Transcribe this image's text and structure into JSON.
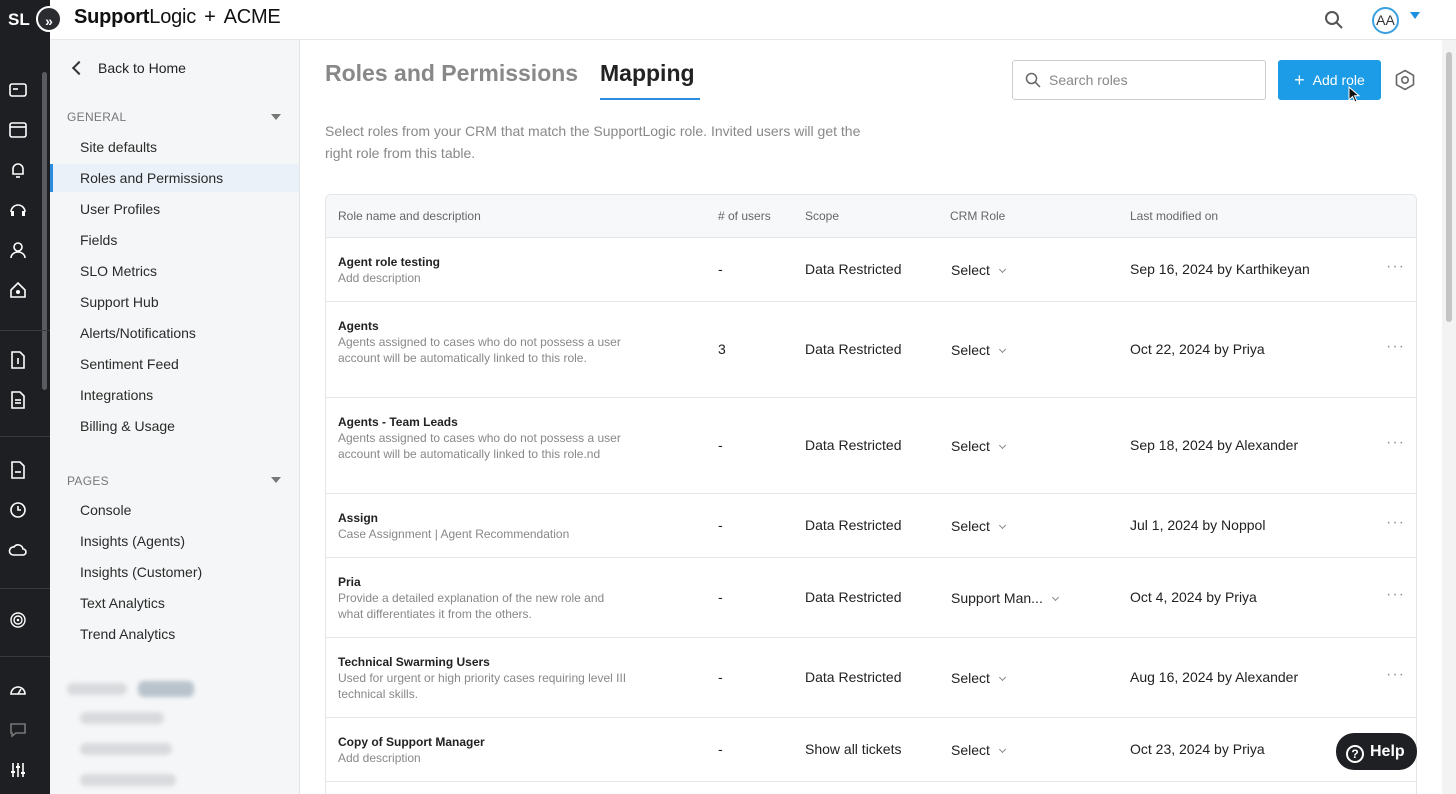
{
  "topbar": {
    "badge": "SL",
    "expand": "»",
    "brand_bold": "Support",
    "brand_rest": "Logic",
    "plus": "+",
    "org": "ACME",
    "avatar": "AA"
  },
  "sidebar": {
    "back": "Back to Home",
    "general_title": "GENERAL",
    "general_items": [
      "Site defaults",
      "Roles and Permissions",
      "User Profiles",
      "Fields",
      "SLO Metrics",
      "Support Hub",
      "Alerts/Notifications",
      "Sentiment Feed",
      "Integrations",
      "Billing & Usage"
    ],
    "pages_title": "PAGES",
    "pages_items": [
      "Console",
      "Insights (Agents)",
      "Insights (Customer)",
      "Text Analytics",
      "Trend Analytics"
    ],
    "active": "Roles and Permissions"
  },
  "main": {
    "tab_roles": "Roles and Permissions",
    "tab_mapping": "Mapping",
    "search_placeholder": "Search roles",
    "add_label": "Add role",
    "description": "Select roles from your CRM that match the SupportLogic role. Invited users will get the right role from this table."
  },
  "table": {
    "headers": [
      "Role name and description",
      "# of users",
      "Scope",
      "CRM Role",
      "Last modified on"
    ],
    "rows": [
      {
        "name": "Agent role testing",
        "desc": "Add description",
        "users": "-",
        "scope": "Data Restricted",
        "crm": "Select",
        "modified": "Sep 16, 2024 by Karthikeyan"
      },
      {
        "name": "Agents",
        "desc": "Agents assigned to cases who do not possess a user account will be automatically linked to this role.",
        "users": "3",
        "scope": "Data Restricted",
        "crm": "Select",
        "modified": "Oct 22, 2024 by Priya"
      },
      {
        "name": "Agents - Team Leads",
        "desc": "Agents assigned to cases who do not possess a user account will be automatically linked to this role.nd",
        "users": "-",
        "scope": "Data Restricted",
        "crm": "Select",
        "modified": "Sep 18, 2024 by Alexander"
      },
      {
        "name": "Assign",
        "desc": "Case Assignment | Agent Recommendation",
        "users": "-",
        "scope": "Data Restricted",
        "crm": "Select",
        "modified": "Jul 1, 2024 by Noppol"
      },
      {
        "name": "Pria",
        "desc": "Provide a detailed explanation of the new role and what differentiates it from the others.",
        "users": "-",
        "scope": "Data Restricted",
        "crm": "Support Man...",
        "modified": "Oct 4, 2024 by Priya"
      },
      {
        "name": "Technical Swarming Users",
        "desc": "Used for urgent or high priority cases requiring level III technical skills.",
        "users": "-",
        "scope": "Data Restricted",
        "crm": "Select",
        "modified": "Aug 16, 2024 by Alexander"
      },
      {
        "name": "Copy of Support Manager",
        "desc": "Add description",
        "users": "-",
        "scope": "Show all tickets",
        "crm": "Select",
        "modified": "Oct 23, 2024 by Priya"
      }
    ],
    "more": "···"
  },
  "help": {
    "label": "Help",
    "q": "?"
  },
  "colors": {
    "accent": "#1c9be6",
    "rail": "#1e1f22"
  }
}
